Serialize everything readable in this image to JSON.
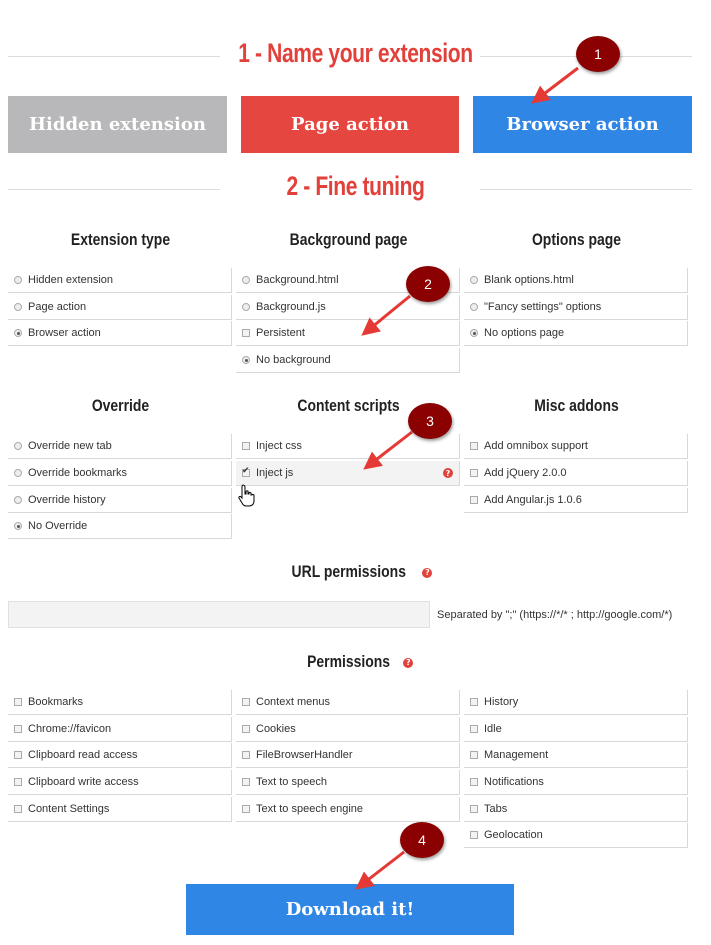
{
  "step1": {
    "title": "1 - Name your extension"
  },
  "extension_types": [
    {
      "label": "Hidden extension",
      "color": "#b8b7b9"
    },
    {
      "label": "Page action",
      "color": "#e54640"
    },
    {
      "label": "Browser action",
      "color": "#2f86e4"
    }
  ],
  "step2": {
    "title": "2 - Fine tuning"
  },
  "extension_type": {
    "title": "Extension type",
    "options": [
      {
        "label": "Hidden extension",
        "selected": false
      },
      {
        "label": "Page action",
        "selected": false
      },
      {
        "label": "Browser action",
        "selected": true
      }
    ]
  },
  "background_page": {
    "title": "Background page",
    "options": [
      {
        "label": "Background.html"
      },
      {
        "label": "Background.js"
      },
      {
        "label": "Persistent"
      },
      {
        "label": "No background"
      }
    ]
  },
  "options_page": {
    "title": "Options page",
    "options": [
      {
        "label": "Blank options.html"
      },
      {
        "label": "\"Fancy settings\" options"
      },
      {
        "label": "No options page"
      }
    ]
  },
  "override": {
    "title": "Override",
    "options": [
      {
        "label": "Override new tab"
      },
      {
        "label": "Override bookmarks"
      },
      {
        "label": "Override history"
      },
      {
        "label": "No Override"
      }
    ]
  },
  "content_scripts": {
    "title": "Content scripts",
    "options": [
      {
        "label": "Inject css"
      },
      {
        "label": "Inject js"
      }
    ]
  },
  "misc_addons": {
    "title": "Misc addons",
    "options": [
      {
        "label": "Add omnibox support"
      },
      {
        "label": "Add jQuery 2.0.0"
      },
      {
        "label": "Add Angular.js 1.0.6"
      }
    ]
  },
  "url_permissions": {
    "title": "URL permissions",
    "value": "",
    "hint": "Separated by \";\" (https://*/* ; http://google.com/*)"
  },
  "permissions": {
    "title": "Permissions",
    "col1": [
      "Bookmarks",
      "Chrome://favicon",
      "Clipboard read access",
      "Clipboard write access",
      "Content Settings"
    ],
    "col2": [
      "Context menus",
      "Cookies",
      "FileBrowserHandler",
      "Text to speech",
      "Text to speech engine"
    ],
    "col3": [
      "History",
      "Idle",
      "Management",
      "Notifications",
      "Tabs",
      "Geolocation"
    ]
  },
  "download": {
    "label": "Download it!"
  },
  "markers": [
    "1",
    "2",
    "3",
    "4"
  ],
  "colors": {
    "accent_red": "#e2403a",
    "marker": "#8b0000",
    "blue": "#2f86e4"
  }
}
